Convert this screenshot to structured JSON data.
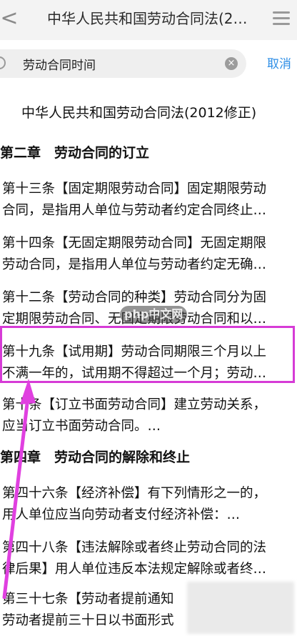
{
  "nav": {
    "title": "中华人民共和国劳动合同法(2…",
    "back_label": "<"
  },
  "search": {
    "value": "劳动合同时间",
    "clear_label": "×",
    "cancel_label": "取消"
  },
  "doc_title": "中华人民共和国劳动合同法(2012修正)",
  "chapters": [
    {
      "label": "第二章　劳动合同的订立"
    },
    {
      "label": "第四章　劳动合同的解除和终止"
    }
  ],
  "results": [
    {
      "line1": "第十三条【固定期限劳动合同】固定期限劳动",
      "line2": "合同，是指用人单位与劳动者约定合同终止…"
    },
    {
      "line1": "第十四条【无固定期限劳动合同】无固定期限",
      "line2": "劳动合同，是指用人单位与劳动者约定无确…"
    },
    {
      "line1": "第十二条【劳动合同的种类】劳动合同分为固",
      "line2": "定期限劳动合同、无固定期限劳动合同和以…"
    },
    {
      "line1": "第十九条【试用期】劳动合同期限三个月以上",
      "line2": "不满一年的，试用期不得超过一个月；劳动…"
    },
    {
      "line1": "第十条【订立书面劳动合同】建立劳动关系，",
      "line2": "应当订立书面劳动合同。…"
    },
    {
      "line1": "第四十六条【经济补偿】有下列情形之一的，",
      "line2": "用人单位应当向劳动者支付经济补偿：…"
    },
    {
      "line1": "第四十八条【违法解除或者终止劳动合同的法",
      "line2": "律后果】用人单位违反本法规定解除或者终…"
    },
    {
      "line1": "第三十七条【劳动者提前通知",
      "line2": "劳动者提前三十日以书面形式"
    }
  ],
  "watermark": "php中文网",
  "colors": {
    "accent": "#2d8ee6",
    "highlight": "#d63bd6"
  },
  "icons": {
    "back": "chevron-left-icon",
    "menu": "menu-icon",
    "search": "search-icon",
    "clear": "clear-icon"
  }
}
